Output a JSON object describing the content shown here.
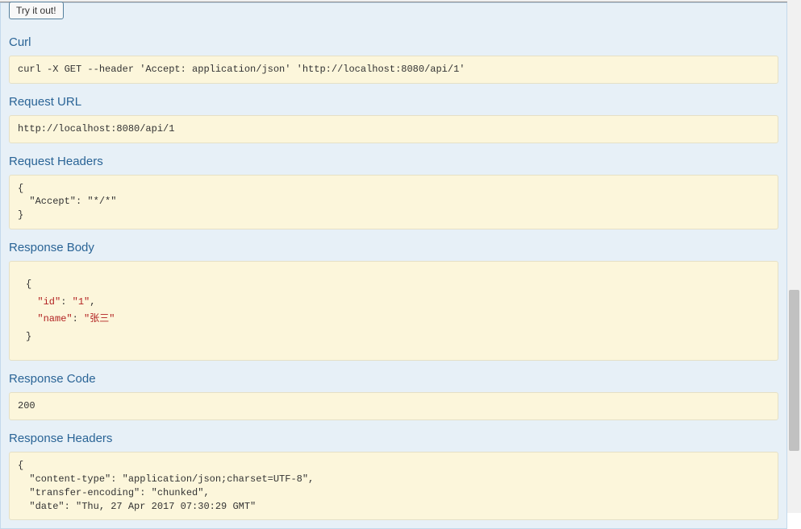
{
  "try_button_label": "Try it out!",
  "sections": {
    "curl": {
      "heading": "Curl",
      "content": "curl -X GET --header 'Accept: application/json' 'http://localhost:8080/api/1'"
    },
    "request_url": {
      "heading": "Request URL",
      "content": "http://localhost:8080/api/1"
    },
    "request_headers": {
      "heading": "Request Headers",
      "content": "{\n  \"Accept\": \"*/*\"\n}"
    },
    "response_body": {
      "heading": "Response Body",
      "json": {
        "id": "1",
        "name": "张三"
      }
    },
    "response_code": {
      "heading": "Response Code",
      "content": "200"
    },
    "response_headers": {
      "heading": "Response Headers",
      "content": "{\n  \"content-type\": \"application/json;charset=UTF-8\",\n  \"transfer-encoding\": \"chunked\",\n  \"date\": \"Thu, 27 Apr 2017 07:30:29 GMT\""
    }
  }
}
